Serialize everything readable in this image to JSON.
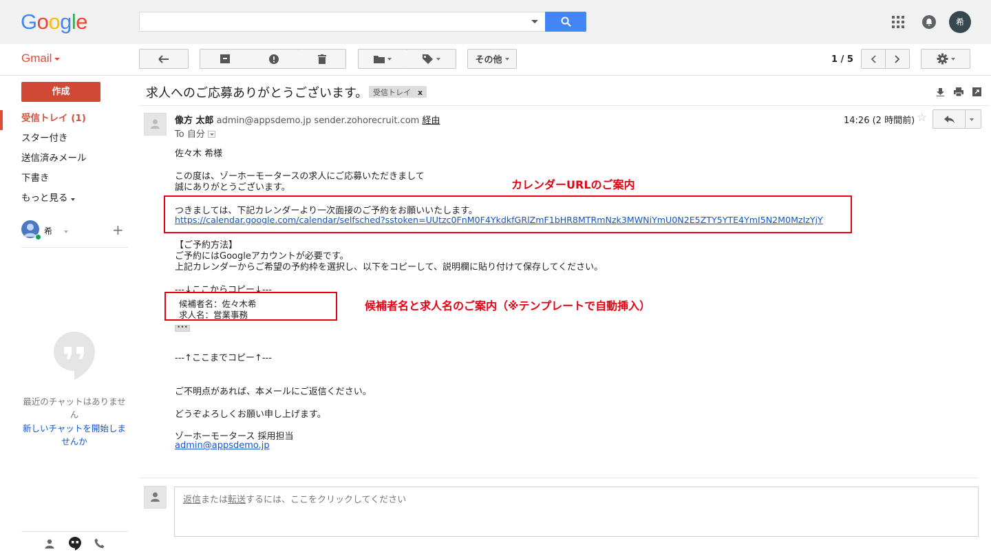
{
  "header": {
    "logo_letters": [
      {
        "ch": "G",
        "color": "#4285f4"
      },
      {
        "ch": "o",
        "color": "#ea4335"
      },
      {
        "ch": "o",
        "color": "#fbbc05"
      },
      {
        "ch": "g",
        "color": "#4285f4"
      },
      {
        "ch": "l",
        "color": "#34a853"
      },
      {
        "ch": "e",
        "color": "#ea4335"
      }
    ],
    "search_value": "",
    "avatar_initial": "希"
  },
  "toolbar": {
    "app_label": "Gmail",
    "more_label": "その他",
    "page_count": "1 / 5"
  },
  "sidebar": {
    "compose_label": "作成",
    "items": [
      {
        "label": "受信トレイ (1)"
      },
      {
        "label": "スター付き"
      },
      {
        "label": "送信済みメール"
      },
      {
        "label": "下書き"
      },
      {
        "label": "もっと見る"
      }
    ],
    "chat_user": "希",
    "no_chats": "最近のチャットはありません",
    "new_chat": "新しいチャットを開始しませんか"
  },
  "message": {
    "subject": "求人へのご応募ありがとうございます。",
    "label_chip": "受信トレイ",
    "label_close": "x",
    "sender_name": "像方 太郎",
    "sender_address": "admin@appsdemo.jp sender.zohorecruit.com",
    "via": "経由",
    "to": "To 自分",
    "time": "14:26 (2 時間前)",
    "body": {
      "greeting": "佐々木 希様",
      "thanks_1": "この度は、ゾーホーモータースの求人にご応募いただきまして",
      "thanks_2": "誠にありがとうございます。",
      "invite": "つきましては、下記カレンダーより一次面接のご予約をお願いいたします。",
      "calendar_url": "https://calendar.google.com/calendar/selfsched?sstoken=UUtzc0FnM0F4YkdkfGRlZmF1bHR8MTRmNzk3MWNiYmU0N2E5ZTY5YTE4YmI5N2M0MzIzYjY",
      "method_title": "【ご予約方法】",
      "method_1": "ご予約にはGoogleアカウントが必要です。",
      "method_2": "上記カレンダーからご希望の予約枠を選択し、以下をコピーして、説明欄に貼り付けて保存してください。",
      "copy_start": "---↓ここからコピー↓---",
      "candidate": "候補者名：佐々木希",
      "job": "求人名：営業事務",
      "ellipsis": "•••",
      "copy_end": "---↑ここまでコピー↑---",
      "questions": "ご不明点があれば、本メールにご返信ください。",
      "regards": "どうぞよろしくお願い申し上げます。",
      "signature": "ゾーホーモータース 採用担当",
      "signature_email": "admin@appsdemo.jp"
    }
  },
  "annotations": {
    "calendar_note": "カレンダーURLのご案内",
    "template_note": "候補者名と求人名のご案内（※テンプレートで自動挿入）",
    "color": "#e60012"
  },
  "reply": {
    "reply_word": "返信",
    "middle": "または",
    "forward_word": "転送",
    "rest": "するには、ここをクリックしてください"
  }
}
